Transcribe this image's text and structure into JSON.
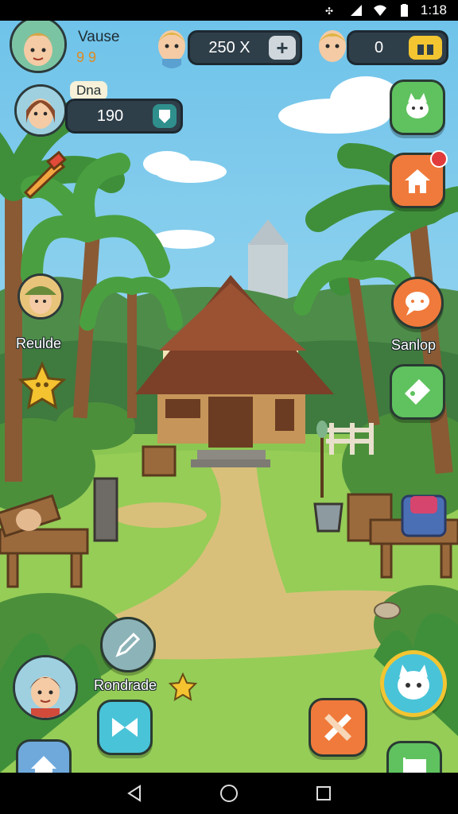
{
  "status": {
    "time": "1:18"
  },
  "hud": {
    "player_name": "Vause",
    "player_level": "9 9",
    "currency_1": "250 X",
    "currency_2": "0",
    "secondary_label": "Dna",
    "secondary_value": "190"
  },
  "side": {
    "left_label": "Reulde",
    "right_label": "Sanlop",
    "bottom_left_label": "Rondrade"
  },
  "colors": {
    "sky": "#8ed3ef",
    "grass": "#8cc652",
    "path": "#d9c07a",
    "hud_bg": "#2f3f4a",
    "accent_green": "#5fc25f",
    "accent_orange": "#f07a3b"
  },
  "icons": {
    "add": "+",
    "chat": "chat-bubble-icon",
    "tag": "tag-icon",
    "home": "house-icon",
    "flag": "flag-icon",
    "edit": "pencil-icon",
    "bow": "bow-icon",
    "pet": "pet-icon"
  }
}
